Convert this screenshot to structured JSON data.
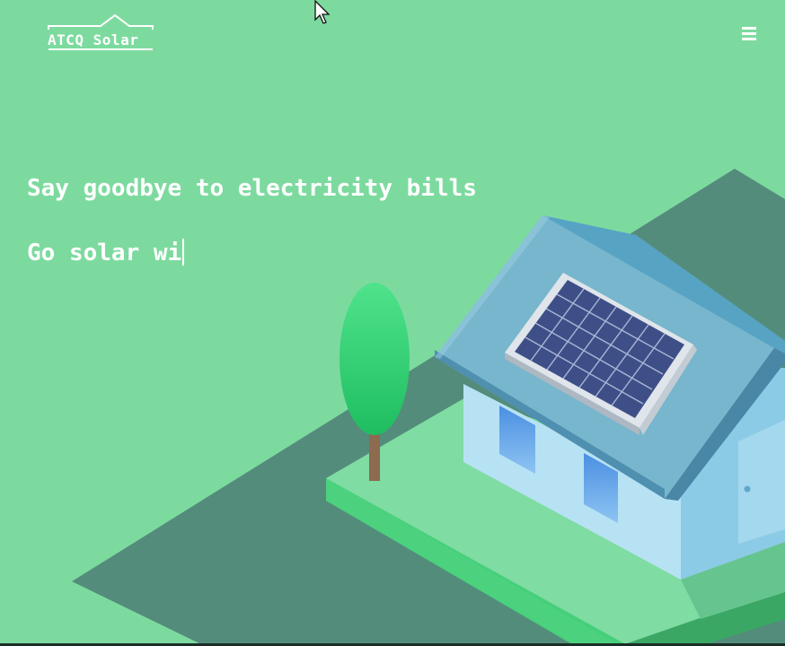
{
  "header": {
    "logo_text": "ATCQ Solar",
    "menu_icon": "hamburger-menu-icon"
  },
  "hero": {
    "line1": "Say goodbye to electricity bills",
    "line2": "Go solar wi"
  },
  "colors": {
    "background": "#7dda9f",
    "ground_shadow": "#548c7c",
    "roof": "#77b6cd",
    "wall": "#b7e2f4",
    "panel": "#3d4f8c",
    "tree": "#2dc96f"
  }
}
